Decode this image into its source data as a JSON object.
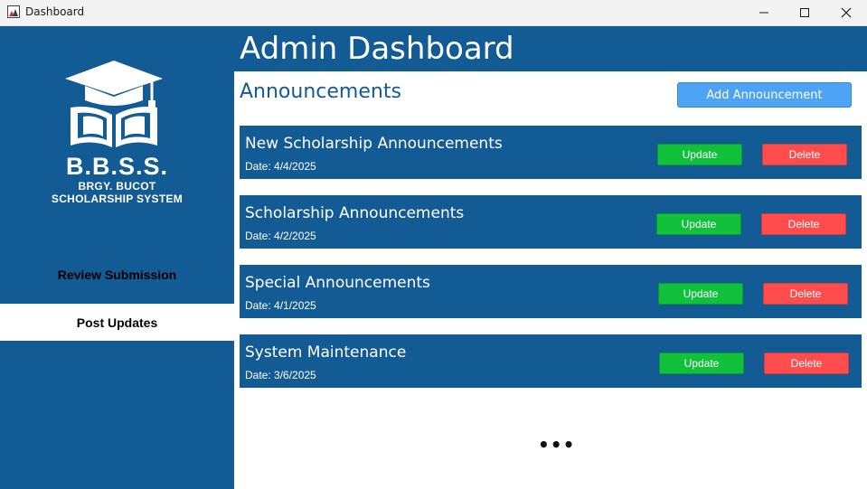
{
  "window": {
    "title": "Dashboard",
    "minimize_icon": "minimize-icon",
    "maximize_icon": "maximize-icon",
    "close_icon": "close-icon"
  },
  "sidebar": {
    "logo_icon": "graduation-cap-book-icon",
    "brand_main": "B.B.S.S.",
    "brand_sub_line1": "BRGY. BUCOT",
    "brand_sub_line2": "SCHOLARSHIP SYSTEM",
    "nav": [
      {
        "label": "Review Submission",
        "active": false
      },
      {
        "label": "Post Updates",
        "active": true
      }
    ]
  },
  "header": {
    "title": "Admin Dashboard"
  },
  "main": {
    "section_title": "Announcements",
    "add_button_label": "Add Announcement",
    "announcements": [
      {
        "title": "New Scholarship Announcements",
        "date": "Date: 4/4/2025",
        "update_label": "Update",
        "delete_label": "Delete"
      },
      {
        "title": "Scholarship Announcements",
        "date": "Date: 4/2/2025",
        "update_label": "Update",
        "delete_label": "Delete"
      },
      {
        "title": "Special Announcements",
        "date": "Date: 4/1/2025",
        "update_label": "Update",
        "delete_label": "Delete"
      },
      {
        "title": "System Maintenance",
        "date": "Date: 3/6/2025",
        "update_label": "Update",
        "delete_label": "Delete"
      }
    ],
    "more_indicator": "•••"
  },
  "colors": {
    "primary": "#135b94",
    "accent_button": "#4da3f5",
    "update": "#12c13b",
    "delete": "#ff4d4d"
  }
}
